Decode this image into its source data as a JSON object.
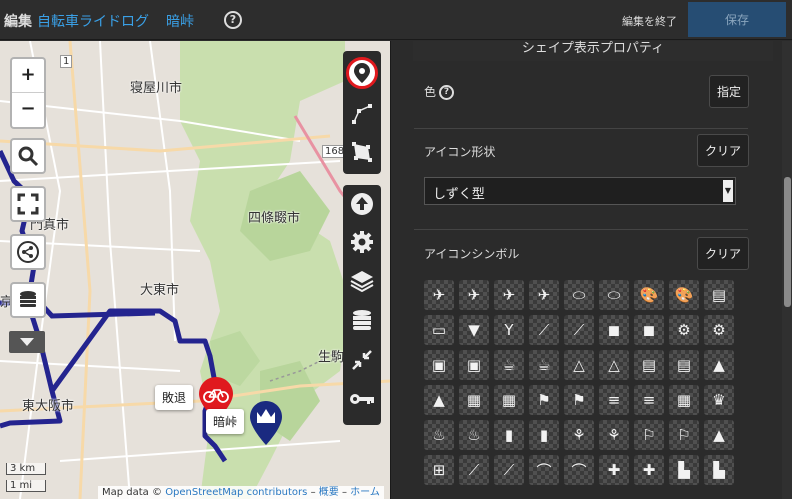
{
  "header": {
    "edit_label": "編集",
    "map_name": "自転車ライドログ",
    "map_name_2": "暗峠",
    "help": "?",
    "finish_label": "編集を終了",
    "save_label": "保存"
  },
  "map": {
    "zoom_in": "+",
    "zoom_out": "−",
    "place_labels": [
      "寝屋川市",
      "四條畷市",
      "大東市",
      "東大阪市",
      "生駒",
      "門真市",
      "京"
    ],
    "road_label": "168",
    "road_label_small": "1",
    "popup_1": "敗退",
    "popup_2": "暗峠",
    "scale_km": "3 km",
    "scale_mi": "1 mi",
    "attribution": {
      "prefix": "Map data ©",
      "osm": "OpenStreetMap contributors",
      "sep1": "–",
      "overview": "概要",
      "sep2": "–",
      "home": "ホーム"
    },
    "accent_red": "#e0191e",
    "route_color": "#24248f",
    "marker_color": "#1a2a80"
  },
  "panel": {
    "title": "シェイプ表示プロパティ",
    "color_label": "色",
    "color_button": "指定",
    "icon_shape_label": "アイコン形状",
    "icon_shape_clear": "クリア",
    "icon_shape_value": "しずく型",
    "icon_symbol_label": "アイコンシンボル",
    "icon_symbol_clear": "クリア",
    "symbols": [
      "✈",
      "✈",
      "✈",
      "✈",
      "⬭",
      "⬭",
      "🎨",
      "🎨",
      "▤",
      "▭",
      "▼",
      "Y",
      "⟋",
      "⟋",
      "◼",
      "◼",
      "⚙",
      "⚙",
      "▣",
      "▣",
      "☕",
      "☕",
      "△",
      "△",
      "▤",
      "▤",
      "▲",
      "▲",
      "▦",
      "▦",
      "⚑",
      "⚑",
      "≡",
      "≡",
      "▦",
      "♛",
      "♨",
      "♨",
      "▮",
      "▮",
      "⚘",
      "⚘",
      "⚐",
      "⚐",
      "▲",
      "⊞",
      "⟋",
      "⟋",
      "⌒",
      "⌒",
      "✚",
      "✚",
      "▙",
      "▙"
    ]
  }
}
